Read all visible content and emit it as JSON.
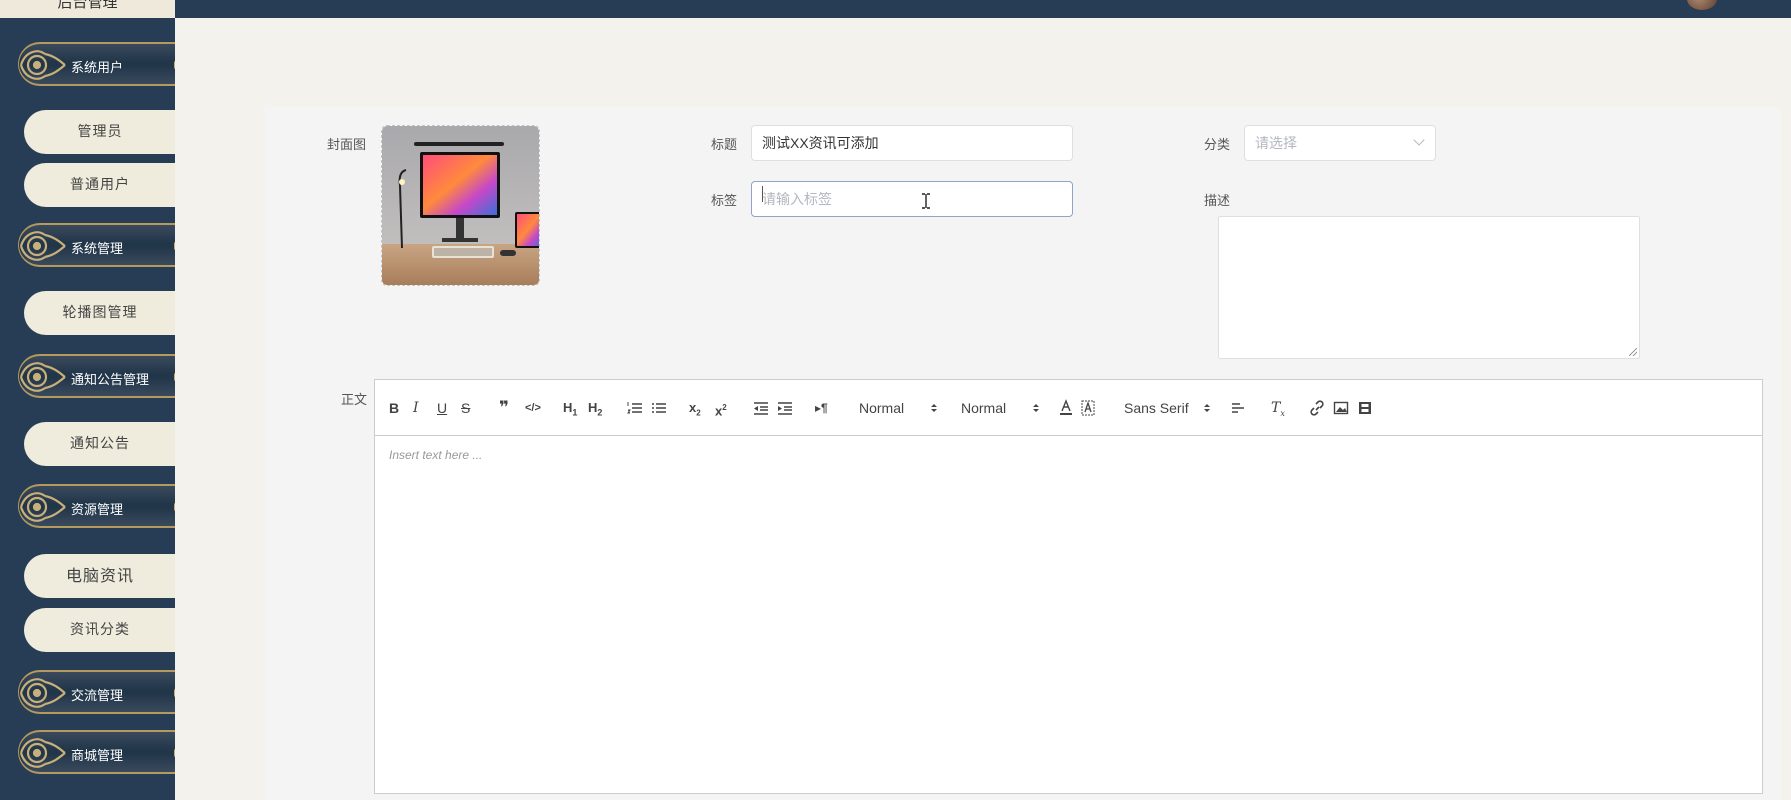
{
  "header": {
    "brand": "后台管理",
    "avatar_icon": "user-avatar"
  },
  "sidebar": {
    "groups": [
      {
        "label": "系统用户",
        "items": [
          "管理员",
          "普通用户"
        ]
      },
      {
        "label": "系统管理",
        "items": [
          "轮播图管理"
        ]
      },
      {
        "label": "通知公告管理",
        "items": [
          "通知公告"
        ]
      },
      {
        "label": "资源管理",
        "items": [
          "电脑资讯",
          "资讯分类"
        ]
      },
      {
        "label": "交流管理",
        "items": []
      },
      {
        "label": "商城管理",
        "items": []
      }
    ]
  },
  "form": {
    "cover_label": "封面图",
    "title_label": "标题",
    "title_value": "测试XX资讯可添加",
    "category_label": "分类",
    "category_placeholder": "请选择",
    "tags_label": "标签",
    "tags_placeholder": "请输入标签",
    "desc_label": "描述",
    "desc_value": "",
    "body_label": "正文"
  },
  "editor": {
    "header_picker": "Normal",
    "size_picker": "Normal",
    "font_picker": "Sans Serif",
    "placeholder": "Insert text here ...",
    "toolbar_icons": [
      "bold-icon",
      "italic-icon",
      "underline-icon",
      "strike-icon",
      "blockquote-icon",
      "code-block-icon",
      "h1-icon",
      "h2-icon",
      "ordered-list-icon",
      "bullet-list-icon",
      "subscript-icon",
      "superscript-icon",
      "outdent-icon",
      "indent-icon",
      "rtl-icon",
      "color-icon",
      "background-icon",
      "align-icon",
      "clean-icon",
      "link-icon",
      "image-icon",
      "video-icon"
    ]
  },
  "colors": {
    "sidebar": "#263d55",
    "gold": "#b59a5e",
    "menu_item_bg": "#efebdd",
    "page_bg": "#f4f2ec"
  }
}
